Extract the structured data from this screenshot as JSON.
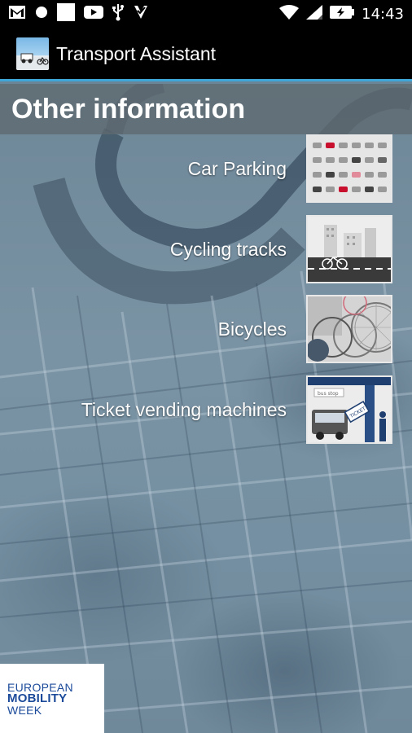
{
  "status_bar": {
    "time": "14:43",
    "icons": [
      "gmail-icon",
      "circle-notification-icon",
      "square-notification-icon",
      "youtube-icon",
      "usb-icon",
      "check-notification-icon",
      "wifi-icon",
      "cell-signal-icon",
      "battery-charging-icon"
    ]
  },
  "app": {
    "title": "Transport Assistant"
  },
  "section": {
    "title": "Other information"
  },
  "menu": {
    "items": [
      {
        "label": "Car Parking",
        "icon": "car-parking-icon"
      },
      {
        "label": "Cycling tracks",
        "icon": "cycling-tracks-icon"
      },
      {
        "label": "Bicycles",
        "icon": "bicycles-icon"
      },
      {
        "label": "Ticket vending machines",
        "icon": "ticket-vending-icon"
      }
    ]
  },
  "logo": {
    "line1": "EUROPEAN",
    "line2": "MOBILITY",
    "line3": "WEEK"
  },
  "colors": {
    "accent": "#3fa7d8",
    "logo_blue": "#1b4a9a"
  }
}
